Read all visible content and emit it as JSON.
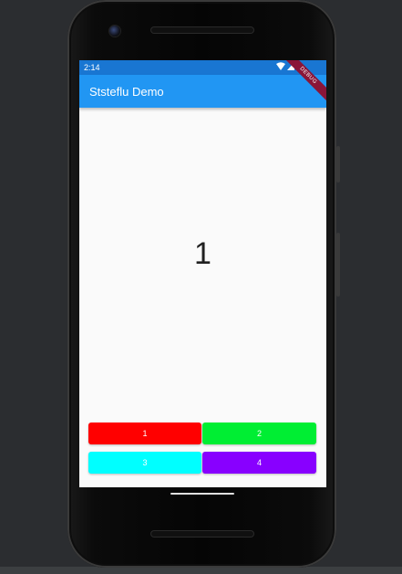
{
  "status_bar": {
    "time": "2:14"
  },
  "app_bar": {
    "title": "Ststeflu Demo"
  },
  "debug_banner": {
    "label": "DEBUG"
  },
  "counter": {
    "value": "1"
  },
  "buttons": [
    {
      "label": "1",
      "color": "#ff0000"
    },
    {
      "label": "2",
      "color": "#00ee33"
    },
    {
      "label": "3",
      "color": "#00ffff"
    },
    {
      "label": "4",
      "color": "#8800ff"
    }
  ],
  "colors": {
    "status_bar": "#1976d2",
    "app_bar": "#2196f3",
    "screen": "#fafafa"
  },
  "icons": [
    "wifi-icon",
    "signal-icon",
    "battery-icon"
  ]
}
